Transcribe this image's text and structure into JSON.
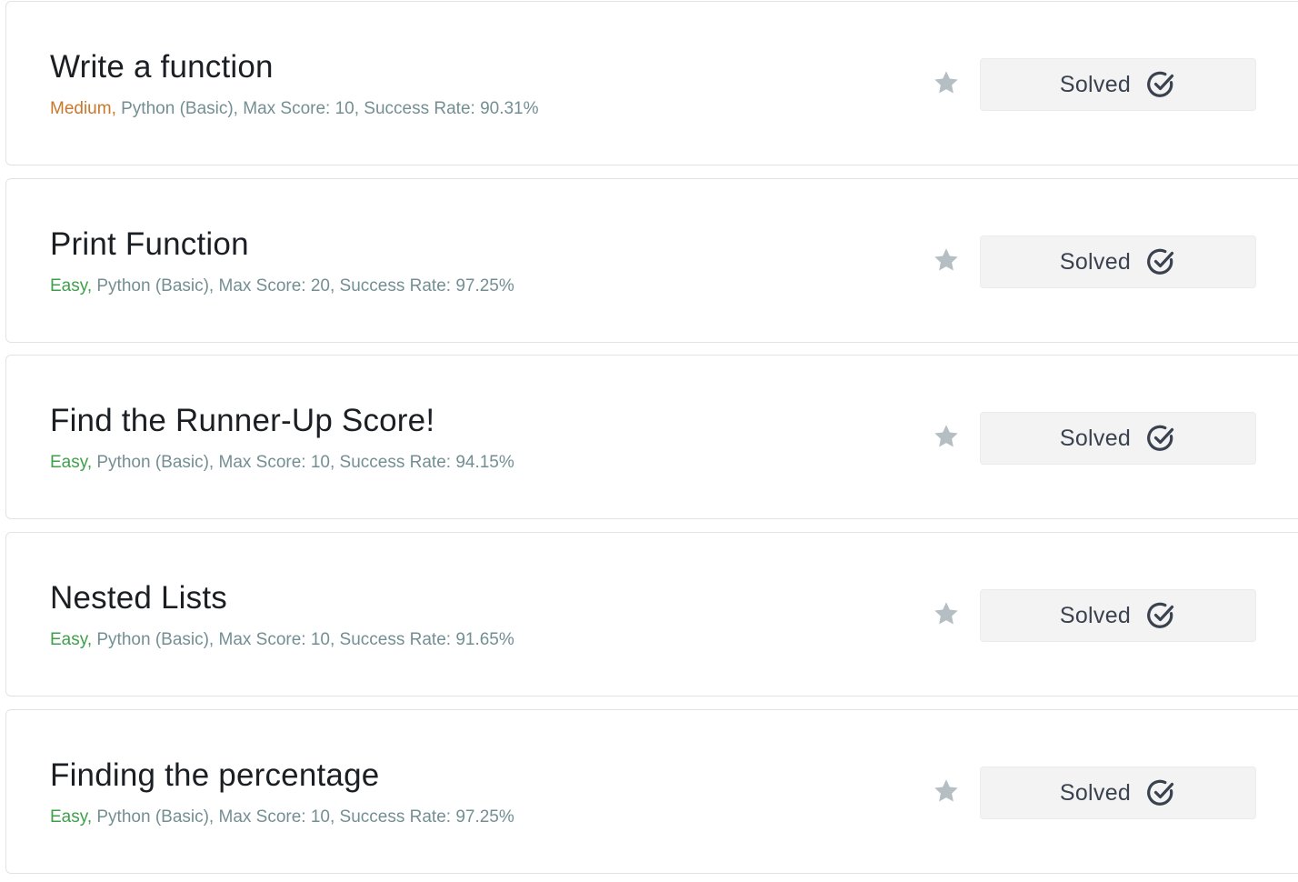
{
  "challenges": [
    {
      "title": "Write a function",
      "difficulty": "Medium,",
      "difficulty_level": "medium",
      "details": " Python (Basic), Max Score: 10, Success Rate: 90.31%",
      "status_label": "Solved",
      "starred": false
    },
    {
      "title": "Print Function",
      "difficulty": "Easy,",
      "difficulty_level": "easy",
      "details": " Python (Basic), Max Score: 20, Success Rate: 97.25%",
      "status_label": "Solved",
      "starred": false
    },
    {
      "title": "Find the Runner-Up Score!",
      "difficulty": "Easy,",
      "difficulty_level": "easy",
      "details": " Python (Basic), Max Score: 10, Success Rate: 94.15%",
      "status_label": "Solved",
      "starred": false
    },
    {
      "title": "Nested Lists",
      "difficulty": "Easy,",
      "difficulty_level": "easy",
      "details": " Python (Basic), Max Score: 10, Success Rate: 91.65%",
      "status_label": "Solved",
      "starred": false
    },
    {
      "title": "Finding the percentage",
      "difficulty": "Easy,",
      "difficulty_level": "easy",
      "details": " Python (Basic), Max Score: 10, Success Rate: 97.25%",
      "status_label": "Solved",
      "starred": false
    }
  ],
  "icons": {
    "star": "star-icon",
    "check": "check-circle-icon"
  },
  "colors": {
    "medium": "#c9772a",
    "easy": "#3fa04a",
    "meta": "#738f93",
    "star": "#b5bfc3",
    "button_bg": "#f3f3f4"
  }
}
